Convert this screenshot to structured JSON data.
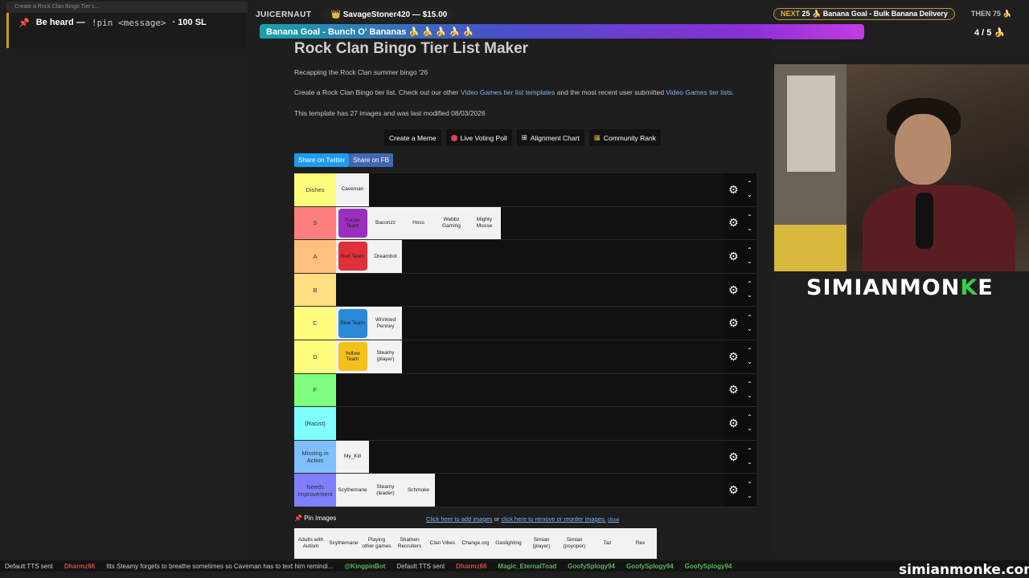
{
  "browser_tab": {
    "title": "Create a Rock Clan Bingo Tier L..."
  },
  "overlay": {
    "pin_prompt": "Be heard —",
    "pin_cmd": "!pin <message>",
    "pin_cost": "· 100 SL",
    "juicer_label": "JUICERNAUT",
    "donor": "SavageStoner420 — $15.00",
    "goal_text": "Banana Goal - Bunch O' Bananas 🍌 🍌 🍌 🍌 🍌",
    "next_label": "NEXT",
    "next_count": "25",
    "next_goal": "Banana Goal - Bulk Banana Delivery",
    "then_label": "THEN",
    "then_count": "75",
    "goal_progress": "4 / 5"
  },
  "page": {
    "title": "Rock Clan Bingo Tier List Maker",
    "subtitle": "Recapping the Rock Clan summer bingo '26",
    "desc_pre": "Create a Rock Clan Bingo tier list. Check out our other ",
    "desc_link1": "Video Games tier list templates",
    "desc_mid": " and the most recent user submitted ",
    "desc_link2": "Video Games tier lists",
    "desc_end": ".",
    "meta": "This template has 27 images and was last modified 08/03/2026",
    "buttons": [
      "Create a Meme",
      "Live Voting Poll",
      "Alignment Chart",
      "Community Rank"
    ],
    "share_twitter": "Share on Twitter",
    "share_fb": "Share on FB",
    "pin_images": "Pin Images",
    "add_images": "Click here to add images",
    "or": " or ",
    "reorder": "click here to remove or reorder images.",
    "close": "close"
  },
  "tiers": [
    {
      "label": "Dishes",
      "color": "#ffff7f",
      "items": [
        {
          "text": "Caveman"
        }
      ]
    },
    {
      "label": "S",
      "color": "#ff7f7f",
      "items": [
        {
          "text": "Purple Team",
          "swatch": "#9b2fbf"
        },
        {
          "text": "Baconzz"
        },
        {
          "text": "Hoss"
        },
        {
          "text": "Webbz Gaming"
        },
        {
          "text": "Mighty Moose"
        }
      ]
    },
    {
      "label": "A",
      "color": "#ffbf7f",
      "items": [
        {
          "text": "Red Team",
          "swatch": "#e0303a"
        },
        {
          "text": "Dreambot"
        }
      ]
    },
    {
      "label": "B",
      "color": "#ffdf7f",
      "items": []
    },
    {
      "label": "C",
      "color": "#ffff7f",
      "items": [
        {
          "text": "Blue Team",
          "swatch": "#2a8ad8"
        },
        {
          "text": "Wrinkled Penney"
        }
      ]
    },
    {
      "label": "D",
      "color": "#ffff7f",
      "items": [
        {
          "text": "Yellow Team",
          "swatch": "#f2c21a"
        },
        {
          "text": "Steamy (player)"
        }
      ]
    },
    {
      "label": "F",
      "color": "#7fff7f",
      "items": []
    },
    {
      "label": "(Racist)",
      "color": "#7fffff",
      "items": []
    },
    {
      "label": "Missing in Action",
      "color": "#7fbfff",
      "items": [
        {
          "text": "My_Kill"
        }
      ]
    },
    {
      "label": "Needs Improvement",
      "color": "#7f7fff",
      "items": [
        {
          "text": "Scythemane"
        },
        {
          "text": "Steamy (leader)"
        },
        {
          "text": "Schmoke"
        }
      ]
    }
  ],
  "bank": [
    "Adults with Autism",
    "Scythemane",
    "Playing other games",
    "Shatnen Recruiters",
    "Clan Vibes",
    "Change.org",
    "Gaslighting",
    "Simian (player)",
    "Simian (psyoper)",
    "Taz",
    "Rex"
  ],
  "brand": {
    "pre": "SIMIANMON",
    "k": "K",
    "post": "E"
  },
  "ticker": [
    {
      "type": "m",
      "text": "Default TTS sent"
    },
    {
      "type": "u",
      "text": "Dharmz66"
    },
    {
      "type": "m",
      "text": "Itts Steamy forgets to breathe sometimes so Caveman has to text him remindi..."
    },
    {
      "type": "g",
      "text": "@KingpinBot"
    },
    {
      "type": "m",
      "text": "Default TTS sent"
    },
    {
      "type": "u",
      "text": "Dharmz66"
    },
    {
      "type": "g",
      "text": "Magic_EternalToad"
    },
    {
      "type": "g",
      "text": "GoofySplogy94"
    },
    {
      "type": "g",
      "text": "GoofySplogy94"
    },
    {
      "type": "g",
      "text": "GoofySplogy94"
    }
  ],
  "watermark": "simianmonke.com",
  "colors": {
    "accent_link": "#7fb4f0",
    "twitter": "#1d9bf0",
    "facebook": "#4267b2"
  }
}
